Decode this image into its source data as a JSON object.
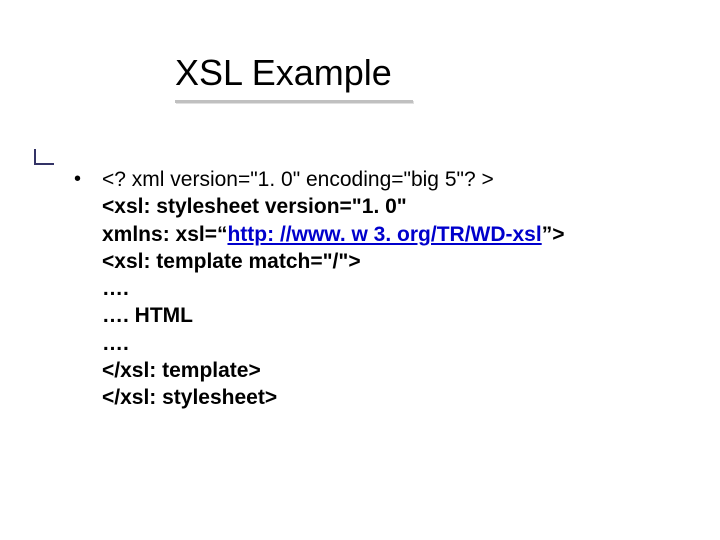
{
  "title": "XSL Example",
  "code": {
    "line1": "<? xml version=\"1. 0\" encoding=\"big 5\"? >",
    "line2": "<xsl: stylesheet version=\"1. 0\"",
    "line3_prefix": "xmlns: xsl=“",
    "line3_link": "http: //www. w 3. org/TR/WD-xsl",
    "line3_suffix": "”>",
    "line4": "<xsl: template match=\"/\">",
    "line5": "….",
    "line6": "…. HTML",
    "line7": "….",
    "line8": "</xsl: template>",
    "line9": "</xsl: stylesheet>"
  }
}
